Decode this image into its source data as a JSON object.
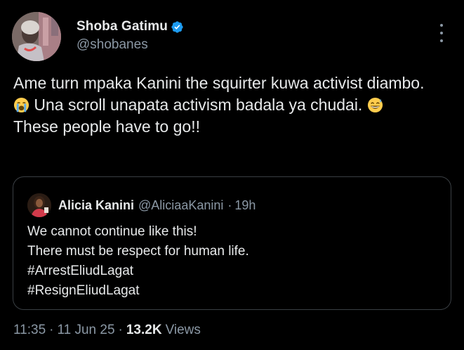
{
  "author": {
    "display_name": "Shoba Gatimu",
    "handle": "@shobanes",
    "verified_icon": "verified-badge-icon",
    "verified_color": "#1d9bf0"
  },
  "tweet": {
    "line1": "Ame turn mpaka Kanini the squirter kuwa activist diambo.",
    "line2_emoji": "crying-face-emoji",
    "line2_text": " Una scroll unapata activism badala ya chudai. ",
    "line2_emoji_end": "grinning-sweat-emoji",
    "line3": "These people have to go!!"
  },
  "quote": {
    "display_name": "Alicia Kanini",
    "handle": "@AliciaaKanini",
    "dot": "·",
    "time": "19h",
    "lines": [
      "We cannot continue like this!",
      "There must be respect for human life.",
      "#ArrestEliudLagat",
      "#ResignEliudLagat"
    ]
  },
  "meta": {
    "time": "11:35",
    "sep1": "·",
    "date": "11 Jun 25",
    "sep2": "·",
    "views_count": "13.2K",
    "views_label": "Views"
  },
  "colors": {
    "background": "#000000",
    "text_primary": "#e7e9ea",
    "text_secondary": "#8b98a5",
    "border": "#3a3f44"
  },
  "icons": {
    "more": "more-options-icon"
  }
}
